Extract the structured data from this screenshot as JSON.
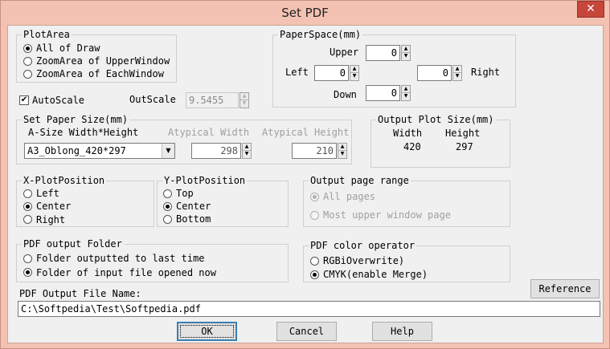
{
  "window": {
    "title": "Set PDF",
    "close_glyph": "✕"
  },
  "plot_area": {
    "legend": "PlotArea",
    "options": [
      "All of Draw",
      "ZoomArea of UpperWindow",
      "ZoomArea of  EachWindow"
    ],
    "selected": 0
  },
  "paper_space": {
    "legend": "PaperSpace(mm)",
    "upper_label": "Upper",
    "upper_value": "0",
    "left_label": "Left",
    "left_value": "0",
    "right_label": "Right",
    "right_value": "0",
    "down_label": "Down",
    "down_value": "0"
  },
  "autoscale": {
    "label": "AutoScale",
    "checked": true,
    "check_glyph": "✔"
  },
  "outscale": {
    "label": "OutScale",
    "value": "9.5455"
  },
  "paper_size": {
    "legend": "Set Paper Size(mm)",
    "asize_label": "A-Size Width*Height",
    "selected": "A3_Oblong_420*297",
    "atypical_width_label": "Atypical Width",
    "atypical_width_value": "298",
    "atypical_height_label": "Atypical Height",
    "atypical_height_value": "210"
  },
  "output_plot_size": {
    "legend": "Output Plot Size(mm)",
    "width_label": "Width",
    "width_value": "420",
    "height_label": "Height",
    "height_value": "297"
  },
  "x_plot_position": {
    "legend": "X-PlotPosition",
    "options": [
      "Left",
      "Center",
      "Right"
    ],
    "selected": 1
  },
  "y_plot_position": {
    "legend": "Y-PlotPosition",
    "options": [
      "Top",
      "Center",
      "Bottom"
    ],
    "selected": 1
  },
  "output_page_range": {
    "legend": "Output page range",
    "options": [
      "All pages",
      "Most upper window page"
    ],
    "selected": 0
  },
  "pdf_output_folder": {
    "legend": "PDF output Folder",
    "options": [
      "Folder outputted to last time",
      "Folder of input file opened now"
    ],
    "selected": 1
  },
  "pdf_color_operator": {
    "legend": "PDF color operator",
    "options": [
      "RGBiOverwrite)",
      "CMYK(enable Merge)"
    ],
    "selected": 1
  },
  "reference_button": "Reference",
  "file_name": {
    "label": "PDF Output File Name:",
    "value": "C:\\Softpedia\\Test\\Softpedia.pdf"
  },
  "buttons": {
    "ok": "OK",
    "cancel": "Cancel",
    "help": "Help"
  },
  "spin_glyphs": {
    "up": "▲",
    "down": "▼"
  },
  "combo_arrow_glyph": "▼"
}
